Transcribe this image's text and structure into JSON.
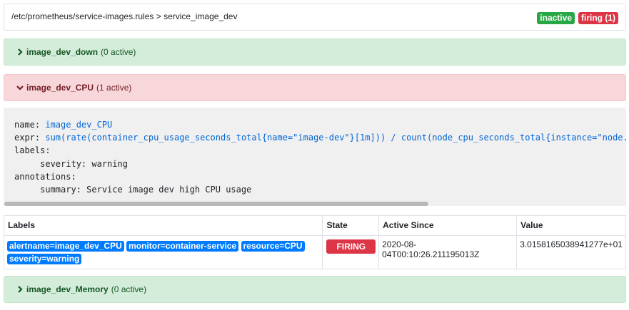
{
  "header": {
    "path": "/etc/prometheus/service-images.rules > service_image_dev",
    "badges": {
      "inactive": "inactive",
      "firing": "firing (1)"
    }
  },
  "rules": [
    {
      "name": "image_dev_down",
      "status": "(0 active)"
    },
    {
      "name": "image_dev_CPU",
      "status": "(1 active)"
    },
    {
      "name": "image_dev_Memory",
      "status": "(0 active)"
    }
  ],
  "definition": {
    "name_key": "name:",
    "name_val": "image_dev_CPU",
    "expr_key": "expr:",
    "expr_val": "sum(rate(container_cpu_usage_seconds_total{name=\"image-dev\"}[1m])) / count(node_cpu_seconds_total{instance=\"node.",
    "labels_key": "labels:",
    "severity_line": "     severity: warning",
    "annotations_key": "annotations:",
    "summary_line": "     summary: Service image dev high CPU usage"
  },
  "table": {
    "headers": {
      "labels": "Labels",
      "state": "State",
      "active_since": "Active Since",
      "value": "Value"
    },
    "row": {
      "labels": [
        "alertname=image_dev_CPU",
        "monitor=container-service",
        "resource=CPU",
        "severity=warning"
      ],
      "state": "FIRING",
      "active_since": "2020-08-04T00:10:26.211195013Z",
      "value": "3.0158165038941277e+01"
    }
  },
  "colors": {
    "ok_bg": "#d4edda",
    "ok_text": "#155724",
    "firing_bg": "#f8d7da",
    "firing_text": "#721c24",
    "label_blue": "#007bff",
    "badge_red": "#dc3545",
    "badge_green": "#28a745"
  }
}
